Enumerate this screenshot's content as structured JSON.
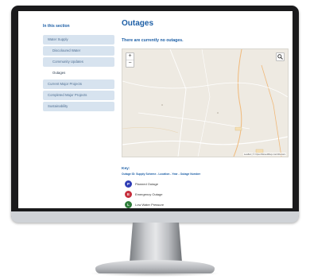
{
  "sidebar": {
    "heading": "In this section",
    "items": [
      {
        "label": "Water Supply"
      },
      {
        "label": "Discoloured Water"
      },
      {
        "label": "Community Updates"
      },
      {
        "label": "Outages"
      },
      {
        "label": "Current Major Projects"
      },
      {
        "label": "Completed Major Projects"
      },
      {
        "label": "Sustainability"
      }
    ]
  },
  "main": {
    "title": "Outages",
    "status": "There are currently no outages.",
    "map": {
      "zoom_in": "+",
      "zoom_out": "−",
      "attribution": "Leaflet | © OpenStreetMap contributors"
    },
    "key": {
      "title": "Key:",
      "description": "Outage ID: Supply Scheme - Location - Year - Outage Number",
      "items": [
        {
          "label": "Planned Outage",
          "letter": "P",
          "color": "#2f3db5"
        },
        {
          "label": "Emergency Outage",
          "letter": "E",
          "color": "#c62f3d"
        },
        {
          "label": "Low Water Pressure",
          "letter": "L",
          "color": "#2f7d3b"
        }
      ]
    }
  },
  "colors": {
    "accent": "#1d5fa6",
    "sidebar_bg": "#d7e3ef"
  }
}
